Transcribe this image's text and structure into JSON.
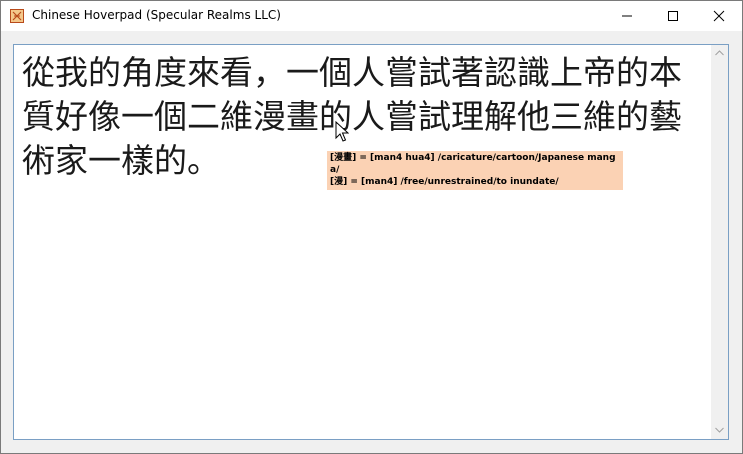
{
  "window": {
    "title": "Chinese Hoverpad (Specular Realms LLC)"
  },
  "titlebar_buttons": {
    "minimize_icon": "minimize-icon",
    "maximize_icon": "maximize-icon",
    "close_icon": "close-icon"
  },
  "editor": {
    "text": "從我的角度來看，一個人嘗試著認識上帝的本質好像一個二維漫畫的人嘗試理解他三維的藝術家一樣的。"
  },
  "popup": {
    "entry1": "[漫畫] = [man4 hua4] /caricature/cartoon/Japanese manga/",
    "entry2": "[漫] = [man4] /free/unrestrained/to inundate/"
  },
  "colors": {
    "popup_bg": "#fbd2b4",
    "client_border": "#7a9fc4"
  }
}
